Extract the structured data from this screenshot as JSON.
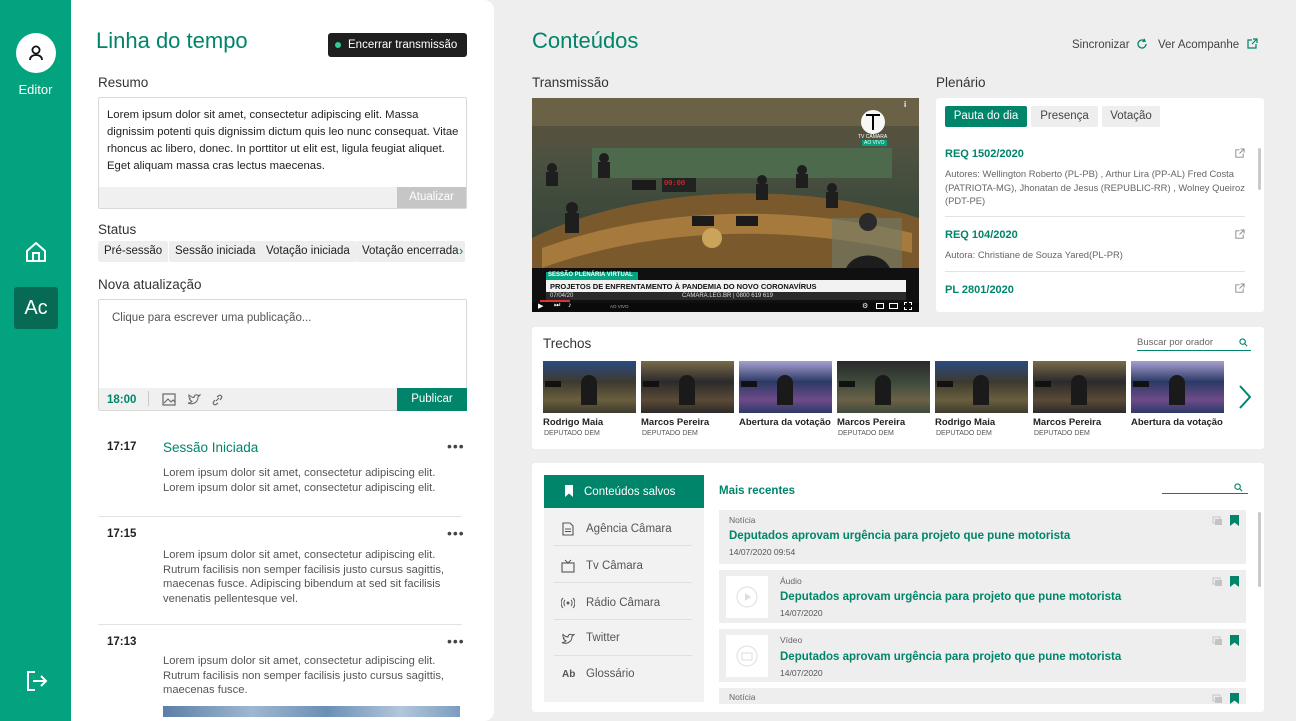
{
  "rail": {
    "user_label": "Editor",
    "ac_label": "Ac"
  },
  "timeline": {
    "title": "Linha do tempo",
    "end_button": "Encerrar transmissão",
    "resumo_label": "Resumo",
    "resumo_text": "Lorem ipsum dolor sit amet, consectetur adipiscing elit. Massa dignissim potenti quis dignissim dictum quis leo nunc consequat. Vitae rhoncus ac libero, donec. In porttitor ut elit est, ligula feugiat aliquet. Eget aliquam massa cras lectus maecenas.",
    "atualizar_button": "Atualizar",
    "status_label": "Status",
    "status_chips": [
      "Pré-sessão",
      "Sessão iniciada",
      "Votação iniciada",
      "Votação encerrada"
    ],
    "nova_label": "Nova atualização",
    "nova_placeholder": "Clique para escrever uma publicação...",
    "nova_time": "18:00",
    "publicar_button": "Publicar",
    "entries": [
      {
        "time": "17:17",
        "title": "Sessão Iniciada",
        "text": "Lorem ipsum dolor sit amet, consectetur adipiscing elit. Lorem ipsum dolor sit amet, consectetur adipiscing elit."
      },
      {
        "time": "17:15",
        "title": "",
        "text": "Lorem ipsum dolor sit amet, consectetur adipiscing elit. Rutrum facilisis non semper facilisis justo cursus sagittis, maecenas fusce. Adipiscing bibendum at sed sit facilisis venenatis pellentesque vel."
      },
      {
        "time": "17:13",
        "title": "",
        "text": "Lorem ipsum dolor sit amet, consectetur adipiscing elit. Rutrum facilisis non semper facilisis justo cursus sagittis, maecenas fusce."
      }
    ]
  },
  "contents": {
    "title": "Conteúdos",
    "sync_label": "Sincronizar",
    "ver_label": "Ver Acompanhe",
    "transmissao_label": "Transmissão",
    "video": {
      "channel": "TV CÂMARA",
      "live": "AO VIVO",
      "banner_top": "SESSÃO PLENÁRIA VIRTUAL",
      "banner_main": "PROJETOS DE ENFRENTAMENTO À PANDEMIA DO NOVO CORONAVÍRUS",
      "banner_date": "07/04/20",
      "banner_site": "CAMARA.LEG.BR | 0800 619 619",
      "clock": "00:00",
      "player_live": "AO VIVO"
    },
    "plenario_label": "Plenário",
    "plenario_tabs": [
      "Pauta do dia",
      "Presença",
      "Votação"
    ],
    "plenario_items": [
      {
        "code": "REQ 1502/2020",
        "authors": "Autores: Wellington Roberto (PL-PB) , Arthur Lira (PP-AL) Fred Costa (PATRIOTA-MG), Jhonatan de Jesus (REPUBLIC-RR) , Wolney Queiroz (PDT-PE)"
      },
      {
        "code": "REQ 104/2020",
        "authors": "Autora: Christiane de Souza Yared(PL-PR)"
      },
      {
        "code": "PL 2801/2020",
        "authors": ""
      }
    ],
    "trechos_label": "Trechos",
    "trechos_search": "Buscar por orador",
    "trechos": [
      {
        "name": "Rodrigo Maia",
        "role": "DEPUTADO DEM"
      },
      {
        "name": "Marcos Pereira",
        "role": "DEPUTADO DEM"
      },
      {
        "name": "Abertura da votação",
        "role": ""
      },
      {
        "name": "Marcos Pereira",
        "role": "DEPUTADO DEM"
      },
      {
        "name": "Rodrigo Maia",
        "role": "DEPUTADO DEM"
      },
      {
        "name": "Marcos Pereira",
        "role": "DEPUTADO DEM"
      },
      {
        "name": "Abertura da  votação",
        "role": ""
      }
    ],
    "saved_categories": [
      "Conteúdos salvos",
      "Agência Câmara",
      "Tv Câmara",
      "Rádio Câmara",
      "Twitter",
      "Glossário"
    ],
    "glossario_icon": "Ab",
    "mais_recentes": "Mais recentes",
    "saved_items": [
      {
        "kind": "Notícia",
        "title": "Deputados aprovam urgência para projeto que pune motorista",
        "date": "14/07/2020 09:54"
      },
      {
        "kind": "Áudio",
        "title": "Deputados aprovam urgência para projeto que pune motorista",
        "date": "14/07/2020"
      },
      {
        "kind": "Vídeo",
        "title": "Deputados aprovam urgência para projeto que pune motorista",
        "date": "14/07/2020"
      },
      {
        "kind": "Notícia",
        "title": "",
        "date": ""
      }
    ]
  },
  "colors": {
    "brand": "#02a37e",
    "brand_dark": "#00856a",
    "active": "#066a54"
  }
}
